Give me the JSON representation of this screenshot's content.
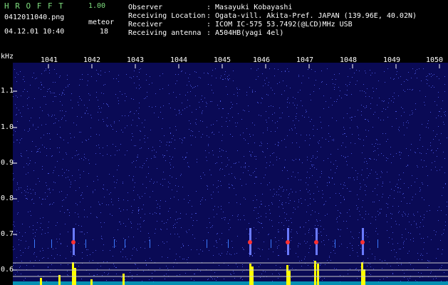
{
  "header": {
    "app_title": "H R O F F T",
    "app_version": "1.00",
    "filename": "0412011040.png",
    "timestamp": "04.12.01 10:40",
    "meteor_label": "meteor",
    "meteor_count": "18"
  },
  "station": {
    "observer_label": "Observer",
    "observer_value": ": Masayuki Kobayashi",
    "location_label": "Receiving Location",
    "location_value": ": Ogata-vill. Akita-Pref. JAPAN (139.96E, 40.02N)",
    "receiver_label": "Receiver",
    "receiver_value": ": ICOM IC-575 53.7492(@LCD)MHz USB",
    "antenna_label": "Receiving antenna",
    "antenna_value": ": A504HB(yagi 4el)"
  },
  "spectrogram": {
    "y_unit": "kHz",
    "y_ticks": [
      "1.1",
      "1.0",
      "0.9",
      "0.8",
      "0.7",
      "0.6"
    ],
    "x_ticks": [
      "1041",
      "1042",
      "1043",
      "1044",
      "1045",
      "1046",
      "1047",
      "1048",
      "1049",
      "1050"
    ],
    "colors": {
      "background": "#0a0a5a",
      "noise": "#5a6aff",
      "echo": "#ff3030",
      "level": "#ffff00",
      "baseline": "#00ffff"
    }
  }
}
